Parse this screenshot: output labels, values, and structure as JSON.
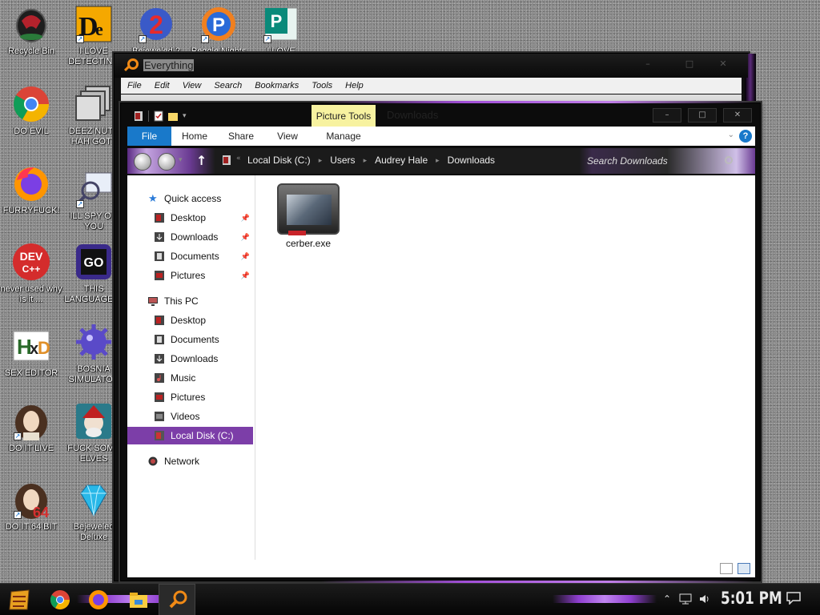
{
  "desktop": {
    "icons": [
      {
        "label": "Recycle Bin",
        "icon": "recycle-bin-icon"
      },
      {
        "label": "I LOVE DETECTING",
        "icon": "detect-it-easy-icon"
      },
      {
        "label": "Bejeweled 2",
        "icon": "bejeweled-2-icon"
      },
      {
        "label": "Peggle Nights",
        "icon": "peggle-icon"
      },
      {
        "label": "I LOVE",
        "icon": "publisher-icon"
      },
      {
        "label": "DO EVIL",
        "icon": "chrome-icon"
      },
      {
        "label": "DEEZ NUTS HAH GOTT",
        "icon": "stacked-windows-icon"
      },
      {
        "label": "FURRYFUCK!",
        "icon": "firefox-icon"
      },
      {
        "label": "ILL SPY ON YOU",
        "icon": "spy-icon"
      },
      {
        "label": "never used why is it ...",
        "icon": "dev-cpp-icon"
      },
      {
        "label": "THIS LANGUAGE ...",
        "icon": "golang-icon"
      },
      {
        "label": "SEX EDITOR",
        "icon": "hxd-icon"
      },
      {
        "label": "BOSNIA SIMULATOR",
        "icon": "mine-icon"
      },
      {
        "label": "DO IT LIVE",
        "icon": "portrait-icon"
      },
      {
        "label": "FUCK SOME ELVES",
        "icon": "elf-icon"
      },
      {
        "label": "DO IT 64 BIT",
        "icon": "portrait-64-icon"
      },
      {
        "label": "Bejeweled Deluxe",
        "icon": "gem-icon"
      }
    ]
  },
  "everything": {
    "title": "Everything",
    "menu": [
      "File",
      "Edit",
      "View",
      "Search",
      "Bookmarks",
      "Tools",
      "Help"
    ],
    "window_controls": [
      "–",
      "□",
      "✕"
    ]
  },
  "explorer": {
    "context_tab": "Picture Tools",
    "title": "Downloads",
    "window_controls": [
      "–",
      "□",
      "✕"
    ],
    "ribbon_tabs": [
      "File",
      "Home",
      "Share",
      "View",
      "Manage"
    ],
    "help_label": "?",
    "expand_ribbon": "⌄",
    "breadcrumb": [
      "Local Disk (C:)",
      "Users",
      "Audrey Hale",
      "Downloads"
    ],
    "search_placeholder": "Search Downloads",
    "nav": {
      "quick_access": "Quick access",
      "quick_items": [
        "Desktop",
        "Downloads",
        "Documents",
        "Pictures"
      ],
      "this_pc": "This PC",
      "pc_items": [
        "Desktop",
        "Documents",
        "Downloads",
        "Music",
        "Pictures",
        "Videos",
        "Local Disk (C:)"
      ],
      "network": "Network",
      "selected": "Local Disk (C:)"
    },
    "files": [
      {
        "name": "cerber.exe",
        "icon": "executable-icon"
      }
    ]
  },
  "taskbar": {
    "apps": [
      "start-icon",
      "chrome-icon",
      "firefox-icon",
      "file-explorer-icon",
      "everything-icon"
    ],
    "clock": "5:01 PM",
    "tray_icons": [
      "chevron-up-icon",
      "network-icon",
      "volume-icon",
      "notification-icon"
    ]
  },
  "colors": {
    "accent_purple": "#7c3ea8",
    "file_tab_blue": "#1979ca",
    "picture_tools_yellow": "#f7f2a0"
  }
}
